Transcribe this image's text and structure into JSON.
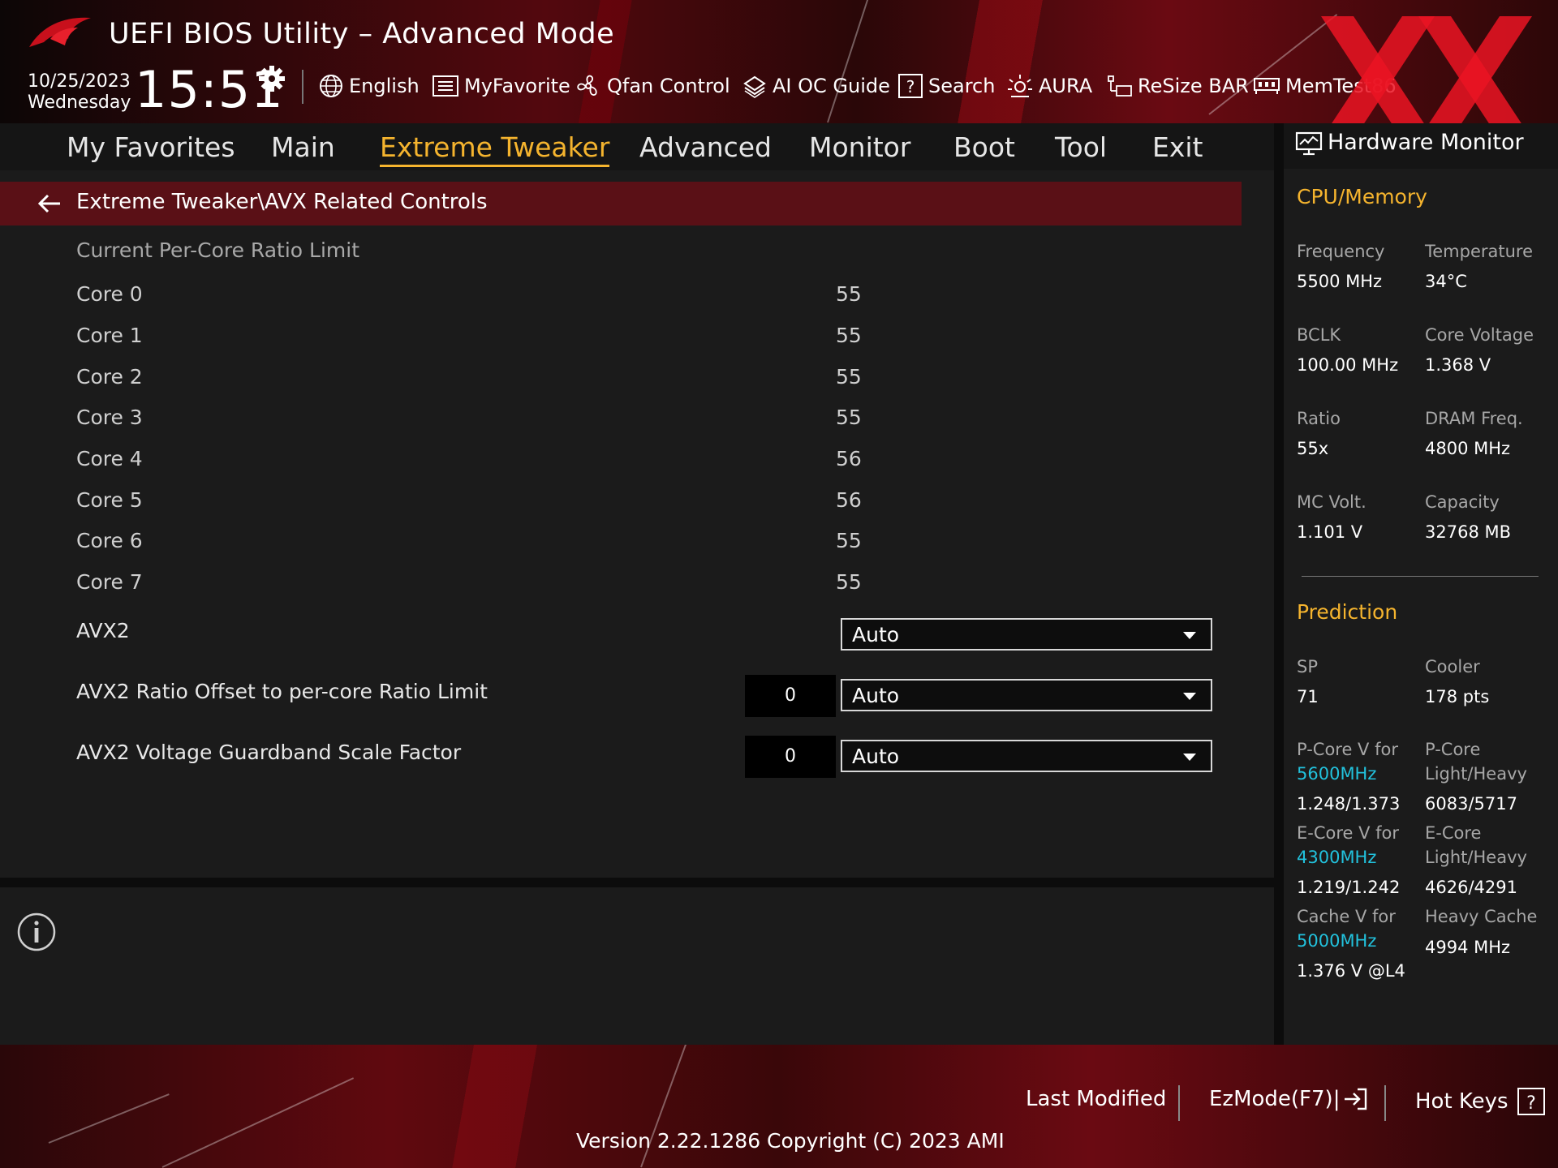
{
  "header": {
    "title": "UEFI BIOS Utility – Advanced Mode",
    "date": "10/25/2023",
    "weekday": "Wednesday",
    "time": "15:51",
    "tools": [
      {
        "label": "English",
        "icon": "globe-icon"
      },
      {
        "label": "MyFavorite",
        "icon": "favorite-list-icon"
      },
      {
        "label": "Qfan Control",
        "icon": "fan-icon"
      },
      {
        "label": "AI OC Guide",
        "icon": "ai-chip-icon"
      },
      {
        "label": "Search",
        "icon": "question-box-icon"
      },
      {
        "label": "AURA",
        "icon": "aura-light-icon"
      },
      {
        "label": "ReSize BAR",
        "icon": "resize-bar-icon"
      },
      {
        "label": "MemTest86",
        "icon": "memory-icon"
      }
    ]
  },
  "menu": {
    "tabs": [
      "My Favorites",
      "Main",
      "Extreme Tweaker",
      "Advanced",
      "Monitor",
      "Boot",
      "Tool",
      "Exit"
    ],
    "active": "Extreme Tweaker"
  },
  "main": {
    "breadcrumb": "Extreme Tweaker\\AVX Related Controls",
    "section_label": "Current Per-Core Ratio Limit",
    "cores": [
      {
        "name": "Core 0",
        "value": "55"
      },
      {
        "name": "Core 1",
        "value": "55"
      },
      {
        "name": "Core 2",
        "value": "55"
      },
      {
        "name": "Core 3",
        "value": "55"
      },
      {
        "name": "Core 4",
        "value": "56"
      },
      {
        "name": "Core 5",
        "value": "56"
      },
      {
        "name": "Core 6",
        "value": "55"
      },
      {
        "name": "Core 7",
        "value": "55"
      }
    ],
    "settings": [
      {
        "label": "AVX2",
        "value": "Auto",
        "num": null
      },
      {
        "label": "AVX2 Ratio Offset to per-core Ratio Limit",
        "value": "Auto",
        "num": "0"
      },
      {
        "label": "AVX2 Voltage Guardband Scale Factor",
        "value": "Auto",
        "num": "0"
      }
    ]
  },
  "hwmon": {
    "title": "Hardware Monitor",
    "cpu_section": "CPU/Memory",
    "cpu": [
      {
        "k1": "Frequency",
        "v1": "5500 MHz",
        "k2": "Temperature",
        "v2": "34°C"
      },
      {
        "k1": "BCLK",
        "v1": "100.00 MHz",
        "k2": "Core Voltage",
        "v2": "1.368 V"
      },
      {
        "k1": "Ratio",
        "v1": "55x",
        "k2": "DRAM Freq.",
        "v2": "4800 MHz"
      },
      {
        "k1": "MC Volt.",
        "v1": "1.101 V",
        "k2": "Capacity",
        "v2": "32768 MB"
      }
    ],
    "prediction_section": "Prediction",
    "sp_label": "SP",
    "sp_value": "71",
    "cooler_label": "Cooler",
    "cooler_value": "178 pts",
    "pcore_v_label": "P-Core V for",
    "pcore_v_freq": "5600MHz",
    "pcore_v_value": "1.248/1.373",
    "pcore_lh_label1": "P-Core",
    "pcore_lh_label2": "Light/Heavy",
    "pcore_lh_value": "6083/5717",
    "ecore_v_label": "E-Core V for",
    "ecore_v_freq": "4300MHz",
    "ecore_v_value": "1.219/1.242",
    "ecore_lh_label1": "E-Core",
    "ecore_lh_label2": "Light/Heavy",
    "ecore_lh_value": "4626/4291",
    "cache_v_label": "Cache V for",
    "cache_v_freq": "5000MHz",
    "cache_v_value": "1.376 V @L4",
    "heavy_cache_label": "Heavy Cache",
    "heavy_cache_value": "4994 MHz"
  },
  "footer": {
    "last_modified": "Last Modified",
    "ezmode": "EzMode(F7)|",
    "hotkeys": "Hot Keys",
    "version": "Version 2.22.1286 Copyright (C) 2023 AMI"
  },
  "colors": {
    "accent": "#f5b42e",
    "cyan": "#22c2dd",
    "brand_red": "#5a1016"
  }
}
